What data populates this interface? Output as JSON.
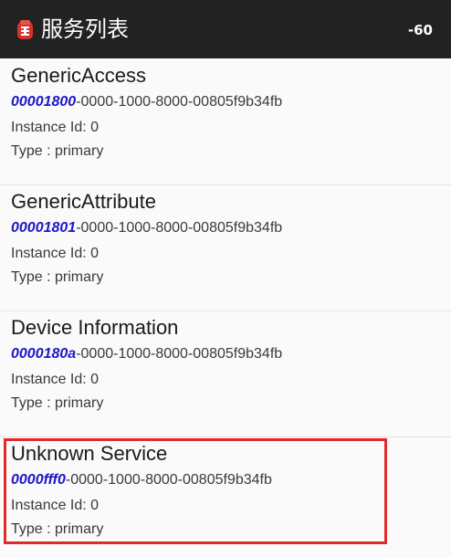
{
  "header": {
    "title": "服务列表",
    "rssi": "-60",
    "icon": "app-icon"
  },
  "services": [
    {
      "name": "GenericAccess",
      "uuid_prefix": "00001800",
      "uuid_rest": "-0000-1000-8000-00805f9b34fb",
      "instance": "Instance Id: 0",
      "type": "Type : primary"
    },
    {
      "name": "GenericAttribute",
      "uuid_prefix": "00001801",
      "uuid_rest": "-0000-1000-8000-00805f9b34fb",
      "instance": "Instance Id: 0",
      "type": "Type : primary"
    },
    {
      "name": "Device Information",
      "uuid_prefix": "0000180a",
      "uuid_rest": "-0000-1000-8000-00805f9b34fb",
      "instance": "Instance Id: 0",
      "type": "Type : primary"
    },
    {
      "name": "Unknown Service",
      "uuid_prefix": "0000fff0",
      "uuid_rest": "-0000-1000-8000-00805f9b34fb",
      "instance": "Instance Id: 0",
      "type": "Type : primary"
    }
  ],
  "colors": {
    "titlebar": "#222222",
    "uuid_prefix": "#1c18c8",
    "highlight": "#e02a2a"
  }
}
